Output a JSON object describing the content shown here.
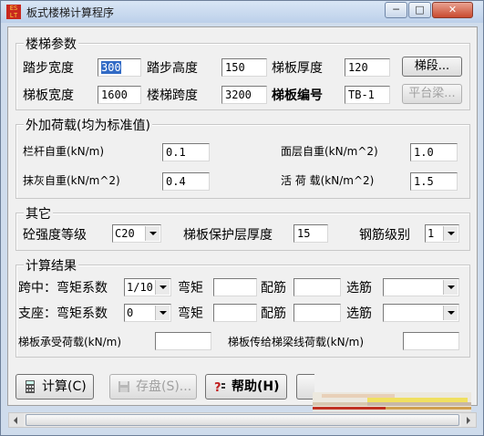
{
  "window": {
    "title": "板式楼梯计算程序",
    "icon_text": "ES LT",
    "minimize": "─",
    "maximize": "□",
    "close": "✕"
  },
  "params": {
    "legend": "楼梯参数",
    "tread_width_label": "踏步宽度",
    "tread_width": "300",
    "tread_height_label": "踏步高度",
    "tread_height": "150",
    "slab_thickness_label": "梯板厚度",
    "slab_thickness": "120",
    "segment_button": "梯段...",
    "slab_width_label": "梯板宽度",
    "slab_width": "1600",
    "span_label": "楼梯跨度",
    "span": "3200",
    "slab_id_label": "梯板编号",
    "slab_id": "TB-1",
    "landing_button": "平台梁..."
  },
  "loads": {
    "legend": "外加荷载(均为标准值)",
    "railing_label": "栏杆自重(kN/m)",
    "railing": "0.1",
    "surface_label": "面层自重(kN/m^2)",
    "surface": "1.0",
    "plaster_label": "抹灰自重(kN/m^2)",
    "plaster": "0.4",
    "live_label": "活 荷 载(kN/m^2)",
    "live": "1.5"
  },
  "other": {
    "legend": "其它",
    "concrete_label": "砼强度等级",
    "concrete": "C20",
    "cover_label": "梯板保护层厚度",
    "cover": "15",
    "rebar_label": "钢筋级别",
    "rebar": "1"
  },
  "results": {
    "legend": "计算结果",
    "mid_label": "跨中：弯矩系数",
    "mid_coef": "1/10",
    "moment_label": "弯矩",
    "reinf_label": "配筋",
    "select_label": "选筋",
    "support_label": "支座：弯矩系数",
    "support_coef": "0",
    "capacity_label": "梯板承受荷载(kN/m)",
    "beam_load_label": "梯板传给梯梁线荷载(kN/m)"
  },
  "buttons": {
    "calculate": "计算(C)",
    "save": "存盘(S)...",
    "help": "帮助(H)"
  },
  "colors": {
    "selection": "#316ac5",
    "titlebar": "#c8d8ee"
  }
}
